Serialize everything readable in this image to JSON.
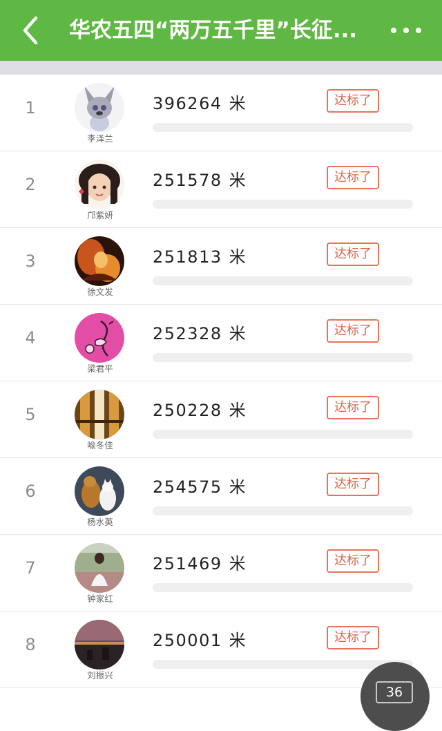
{
  "header": {
    "title": "华农五四“两万五千里”长征...",
    "back_icon": "chevron-left-icon",
    "more_icon": "more-dots-icon",
    "background": "#5fb843"
  },
  "ranking": [
    {
      "rank": "1",
      "name": "李泽兰",
      "distance": "396264",
      "unit": "米",
      "badge": "达标了",
      "progress": 1.0
    },
    {
      "rank": "2",
      "name": "邝紫妍",
      "distance": "251578",
      "unit": "米",
      "badge": "达标了",
      "progress": 1.0
    },
    {
      "rank": "3",
      "name": "徐文发",
      "distance": "251813",
      "unit": "米",
      "badge": "达标了",
      "progress": 1.0
    },
    {
      "rank": "4",
      "name": "梁君平",
      "distance": "252328",
      "unit": "米",
      "badge": "达标了",
      "progress": 1.0
    },
    {
      "rank": "5",
      "name": "喻冬佳",
      "distance": "250228",
      "unit": "米",
      "badge": "达标了",
      "progress": 1.0
    },
    {
      "rank": "6",
      "name": "杨水英",
      "distance": "254575",
      "unit": "米",
      "badge": "达标了",
      "progress": 1.0
    },
    {
      "rank": "7",
      "name": "钟家红",
      "distance": "251469",
      "unit": "米",
      "badge": "达标了",
      "progress": 1.0
    },
    {
      "rank": "8",
      "name": "刘振兴",
      "distance": "250001",
      "unit": "米",
      "badge": "达标了",
      "progress": 1.0
    }
  ],
  "fab": {
    "label": "36"
  },
  "colors": {
    "accent": "#5fb843",
    "badge": "#e0644b"
  }
}
